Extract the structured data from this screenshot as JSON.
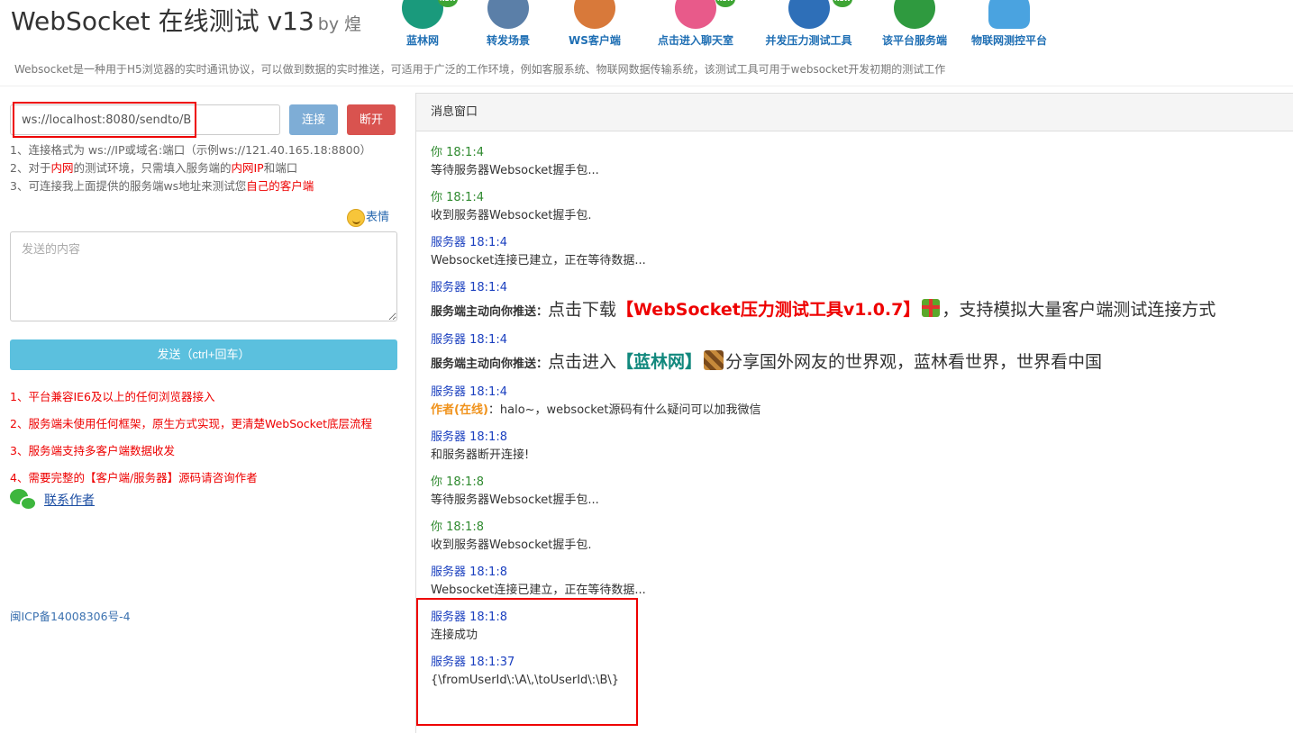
{
  "header": {
    "title": "WebSocket 在线测试 v13",
    "by": "by 煌",
    "nav": [
      {
        "label": "蓝林网",
        "icon": "globe-icon",
        "is_new": true,
        "color": "#1a9a7c"
      },
      {
        "label": "转发场景",
        "icon": "antenna-tower-icon",
        "is_new": false,
        "color": "#5b7fa8"
      },
      {
        "label": "WS客户端",
        "icon": "speaker-icon",
        "is_new": false,
        "color": "#d8793a"
      },
      {
        "label": "点击进入聊天室",
        "icon": "chat-user-icon",
        "is_new": true,
        "color": "#e85a8a"
      },
      {
        "label": "并发压力测试工具",
        "icon": "pencil-ruler-icon",
        "is_new": true,
        "color": "#2e6fb8"
      },
      {
        "label": "该平台服务端",
        "icon": "earth-icon",
        "is_new": false,
        "color": "#2f9a3f"
      },
      {
        "label": "物联网测控平台",
        "icon": "cloud-icon",
        "is_new": false,
        "color": "#4aa3e0"
      }
    ],
    "new_badge": "NEW",
    "description": "Websocket是一种用于H5浏览器的实时通讯协议，可以做到数据的实时推送，可适用于广泛的工作环境，例如客服系统、物联网数据传输系统，该测试工具可用于websocket开发初期的测试工作"
  },
  "left": {
    "url_value": "ws://localhost:8080/sendto/B",
    "connect_label": "连接",
    "disconnect_label": "断开",
    "tips": {
      "t1": "1、连接格式为 ws://IP或域名:端口（示例ws://121.40.165.18:8800）",
      "t2a": "2、对于",
      "t2b": "内网",
      "t2c": "的测试环境，只需填入服务端的",
      "t2d": "内网IP",
      "t2e": "和端口",
      "t3a": "3、可连接我上面提供的服务端ws地址来测试您",
      "t3b": "自己的客户端"
    },
    "emoji_label": "表情",
    "message_placeholder": "发送的内容",
    "send_label": "发送（ctrl+回车）",
    "notices": [
      "1、平台兼容IE6及以上的任何浏览器接入",
      "2、服务端未使用任何框架，原生方式实现，更清楚WebSocket底层流程",
      "3、服务端支持多客户端数据收发",
      "4、需要完整的【客户端/服务器】源码请咨询作者"
    ],
    "contact_label": "联系作者",
    "icp": "闽ICP备14008306号-4"
  },
  "panel": {
    "title": "消息窗口",
    "messages": [
      {
        "who": "你 18:1:4",
        "text": "等待服务器Websocket握手包..."
      },
      {
        "who": "你 18:1:4",
        "text": "收到服务器Websocket握手包."
      },
      {
        "who": "服务器 18:1:4",
        "text": "Websocket连接已建立，正在等待数据..."
      },
      {
        "who": "服务器 18:1:4",
        "push_label": "服务端主动向你推送：",
        "p1": "点击下载",
        "link": "【WebSocket压力测试工具v1.0.7】",
        "p2": "，支持模拟大量客户端测试连接方式"
      },
      {
        "who": "服务器 18:1:4",
        "push_label": "服务端主动向你推送：",
        "p1": "点击进入",
        "link": "【蓝林网】",
        "p2": "分享国外网友的世界观，蓝林看世界，世界看中国"
      },
      {
        "who": "服务器 18:1:4",
        "author": "作者(在线)",
        "text": "：halo~，websocket源码有什么疑问可以加我微信"
      },
      {
        "who": "服务器 18:1:8",
        "text": "和服务器断开连接!"
      },
      {
        "who": "你 18:1:8",
        "text": "等待服务器Websocket握手包..."
      },
      {
        "who": "你 18:1:8",
        "text": "收到服务器Websocket握手包."
      },
      {
        "who": "服务器 18:1:8",
        "text": "Websocket连接已建立，正在等待数据..."
      },
      {
        "who": "服务器 18:1:8",
        "text": "连接成功"
      },
      {
        "who": "服务器 18:1:37",
        "text": "{\\fromUserId\\:\\A\\,\\toUserId\\:\\B\\}"
      }
    ]
  }
}
